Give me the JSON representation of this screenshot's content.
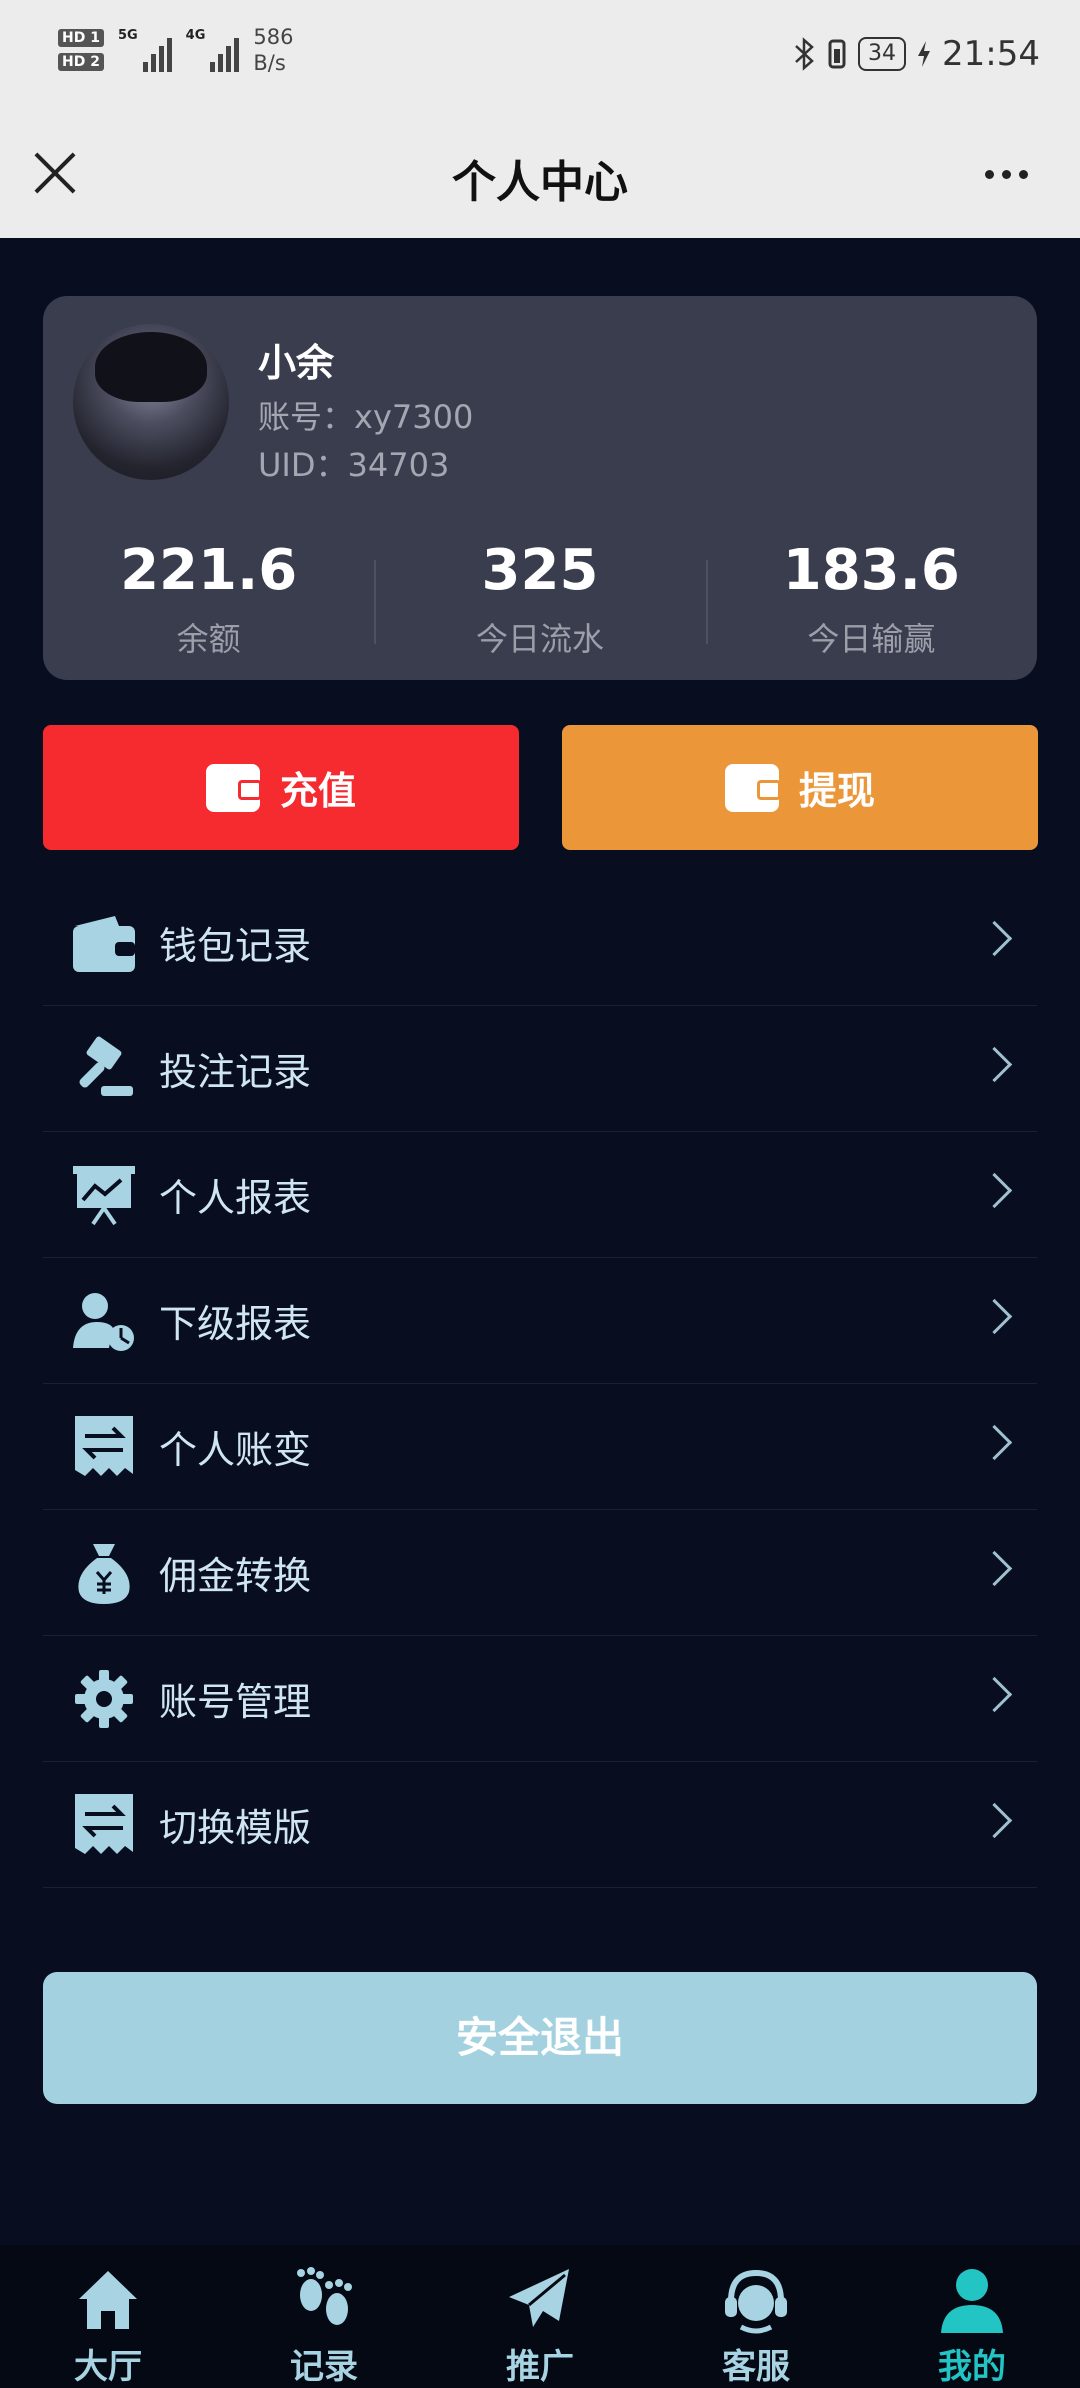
{
  "status_bar": {
    "hd1": "HD 1",
    "hd2": "HD 2",
    "net1": "5G",
    "net2": "4G",
    "speed_value": "586",
    "speed_unit": "B/s",
    "battery": "34",
    "time": "21:54"
  },
  "header": {
    "title": "个人中心"
  },
  "profile": {
    "name": "小余",
    "account": "账号：xy7300",
    "uid": "UID：34703"
  },
  "stats": [
    {
      "value": "221.6",
      "label": "余额"
    },
    {
      "value": "325",
      "label": "今日流水"
    },
    {
      "value": "183.6",
      "label": "今日输赢"
    }
  ],
  "actions": {
    "recharge": "充值",
    "withdraw": "提现"
  },
  "menu": [
    {
      "label": "钱包记录",
      "icon": "wallet-icon"
    },
    {
      "label": "投注记录",
      "icon": "gavel-icon"
    },
    {
      "label": "个人报表",
      "icon": "chart-board-icon"
    },
    {
      "label": "下级报表",
      "icon": "user-pie-icon"
    },
    {
      "label": "个人账变",
      "icon": "transfer-receipt-icon"
    },
    {
      "label": "佣金转换",
      "icon": "money-bag-icon"
    },
    {
      "label": "账号管理",
      "icon": "gear-icon"
    },
    {
      "label": "切换模版",
      "icon": "switch-receipt-icon"
    }
  ],
  "logout": "安全退出",
  "tabs": [
    {
      "label": "大厅",
      "icon": "home-icon"
    },
    {
      "label": "记录",
      "icon": "footprint-icon"
    },
    {
      "label": "推广",
      "icon": "paper-plane-icon"
    },
    {
      "label": "客服",
      "icon": "headset-icon"
    },
    {
      "label": "我的",
      "icon": "person-icon",
      "active": true
    }
  ],
  "colors": {
    "background": "#080d20",
    "card": "#3a3d4e",
    "recharge": "#f52b30",
    "withdraw": "#ec963a",
    "menu_icon": "#a7d3e2",
    "logout": "#a3d1e0",
    "tab_active": "#22c4c4"
  }
}
